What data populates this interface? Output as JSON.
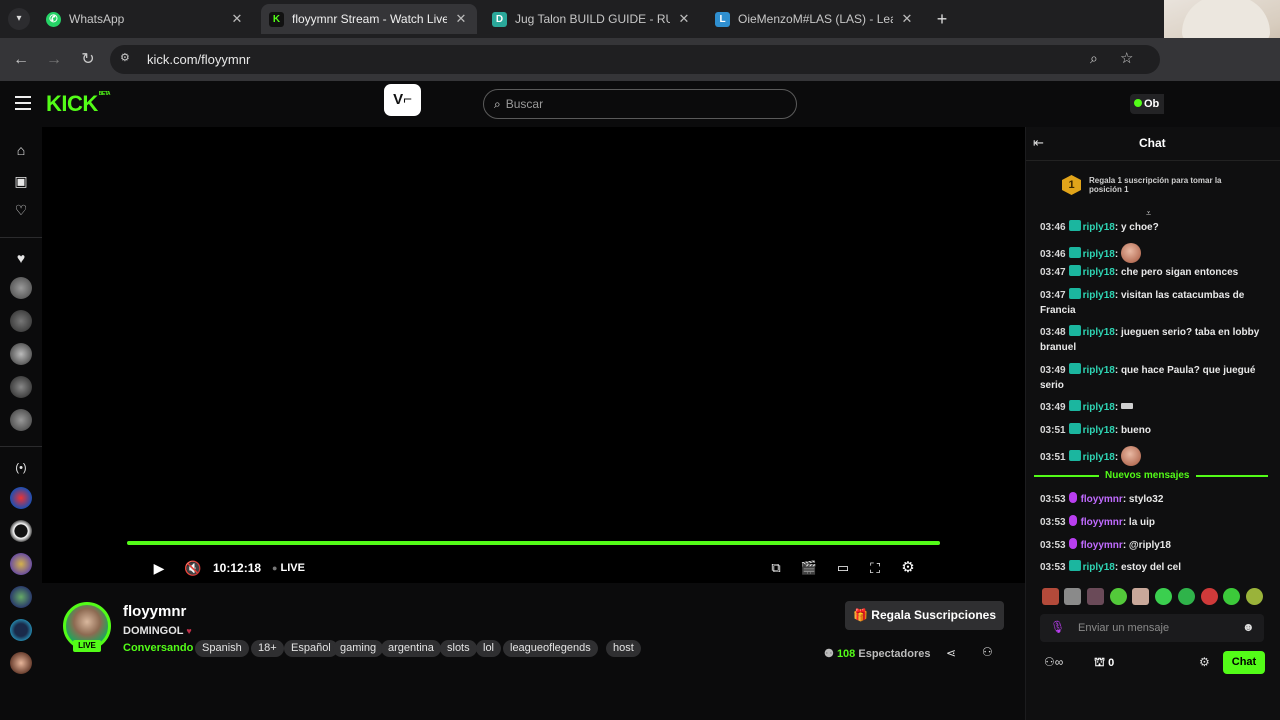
{
  "browser": {
    "tabs": [
      {
        "title": "WhatsApp",
        "favicon": "whatsapp-icon",
        "active": false
      },
      {
        "title": "floyymnr Stream - Watch Live o",
        "favicon": "kick-icon",
        "active": true
      },
      {
        "title": "Jug Talon BUILD GUIDE - RUNE",
        "favicon": "d-icon",
        "active": false
      },
      {
        "title": "OieMenzoM#LAS (LAS) - Leagu",
        "favicon": "l-icon",
        "active": false
      }
    ],
    "url": "kick.com/floyymnr"
  },
  "kick": {
    "logo": "KICK",
    "beta": "BETA",
    "search_placeholder": "Buscar",
    "get_button": "Ob"
  },
  "player": {
    "time": "10:12:18",
    "live": "LIVE",
    "progress": 1.0
  },
  "stream": {
    "streamer": "floyymnr",
    "live_badge": "LIVE",
    "title": "DOMINGOL",
    "category": "Conversando",
    "tags": [
      "Spanish",
      "18+",
      "Español",
      "gaming",
      "argentina",
      "slots",
      "lol",
      "leagueoflegends",
      "host"
    ],
    "gift_button": "Regala Suscripciones",
    "viewers_count": "108",
    "viewers_label": "Espectadores"
  },
  "chat": {
    "title": "Chat",
    "gift_rank": "1",
    "gift_text": "Regala 1 suscripción para tomar la posición 1",
    "messages": [
      {
        "time": "03:46",
        "user": "riply18",
        "text": "y choe?"
      },
      {
        "time": "03:46",
        "user": "riply18",
        "text": ""
      },
      {
        "time": "03:47",
        "user": "riply18",
        "text": "che pero sigan entonces"
      },
      {
        "time": "03:47",
        "user": "riply18",
        "text": "visitan las catacumbas de Francia"
      },
      {
        "time": "03:48",
        "user": "riply18",
        "text": "jueguen serio? taba en lobby branuel"
      },
      {
        "time": "03:49",
        "user": "riply18",
        "text": "que hace Paula? que juegué serio"
      },
      {
        "time": "03:49",
        "user": "riply18",
        "text": ""
      },
      {
        "time": "03:51",
        "user": "riply18",
        "text": "bueno"
      },
      {
        "time": "03:51",
        "user": "riply18",
        "text": ""
      }
    ],
    "new_messages_label": "Nuevos mensajes",
    "new_messages": [
      {
        "time": "03:53",
        "user": "floyymnr",
        "text": "stylo32"
      },
      {
        "time": "03:53",
        "user": "floyymnr",
        "text": "la uip"
      },
      {
        "time": "03:53",
        "user": "floyymnr",
        "text": "@riply18"
      },
      {
        "time": "03:53",
        "user": "riply18",
        "text": "estoy del cel"
      }
    ],
    "input_placeholder": "Enviar un mensaje",
    "points_count": "0",
    "send_button": "Chat",
    "accent": "#53fc18"
  }
}
